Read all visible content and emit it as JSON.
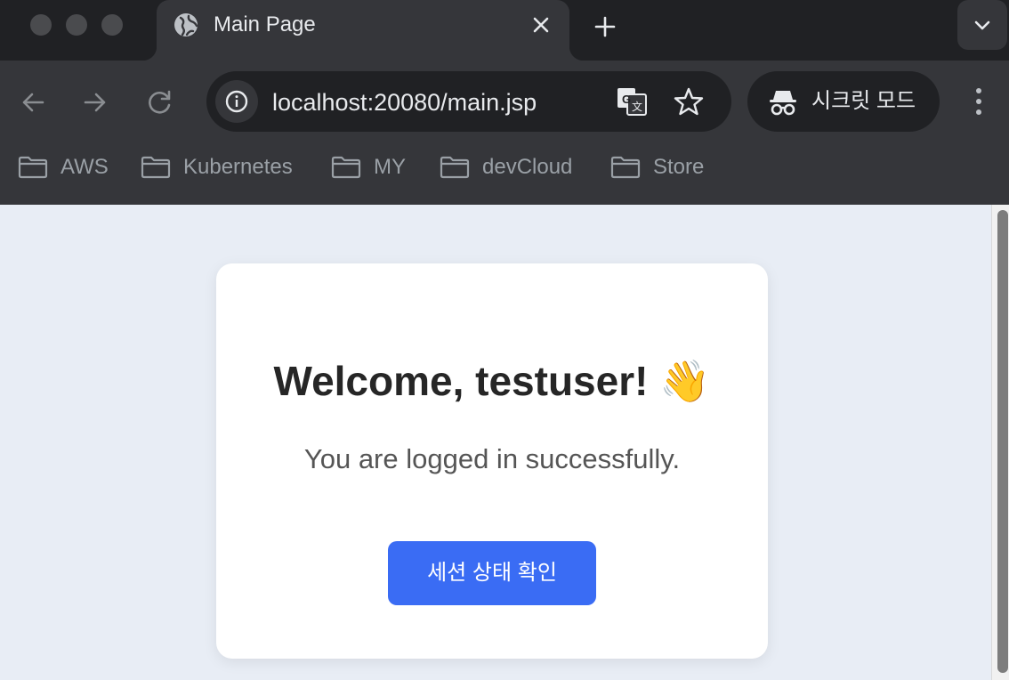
{
  "tab": {
    "title": "Main Page",
    "favicon": "globe-icon"
  },
  "toolbar": {
    "url": "localhost:20080/main.jsp",
    "incognito_label": "시크릿 모드"
  },
  "bookmarks": [
    {
      "label": "AWS",
      "icon": "folder-icon"
    },
    {
      "label": "Kubernetes",
      "icon": "folder-icon"
    },
    {
      "label": "MY",
      "icon": "folder-icon"
    },
    {
      "label": "devCloud",
      "icon": "folder-icon"
    },
    {
      "label": "Store",
      "icon": "folder-icon"
    }
  ],
  "page": {
    "welcome": "Welcome, testuser! 👋",
    "subtitle": "You are logged in successfully.",
    "session_button": "세션 상태 확인",
    "background_color": "#e8edf5",
    "button_color": "#3a6cf4"
  }
}
